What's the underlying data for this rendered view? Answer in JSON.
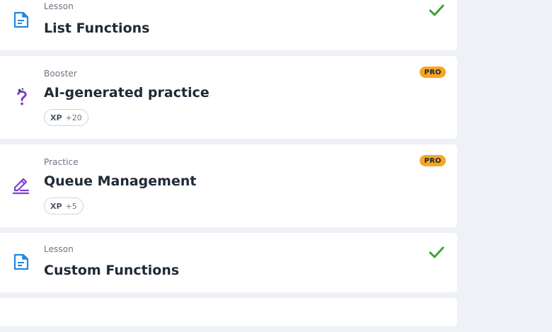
{
  "colors": {
    "accent_blue": "#1e88e5",
    "accent_purple": "#7b3fd1",
    "check_green": "#3aa335",
    "pro_badge": "#f6a623"
  },
  "items": [
    {
      "kind": "Lesson",
      "title": "List Functions",
      "icon": "document-lesson-icon",
      "completed": true
    },
    {
      "kind": "Booster",
      "title": "AI-generated practice",
      "icon": "question-mark-sparkle-icon",
      "badge": "PRO",
      "xp": {
        "label": "XP",
        "value": "+20"
      }
    },
    {
      "kind": "Practice",
      "title": "Queue Management",
      "icon": "pencil-edit-icon",
      "badge": "PRO",
      "xp": {
        "label": "XP",
        "value": "+5"
      }
    },
    {
      "kind": "Lesson",
      "title": "Custom Functions",
      "icon": "document-lesson-icon",
      "completed": true
    }
  ]
}
